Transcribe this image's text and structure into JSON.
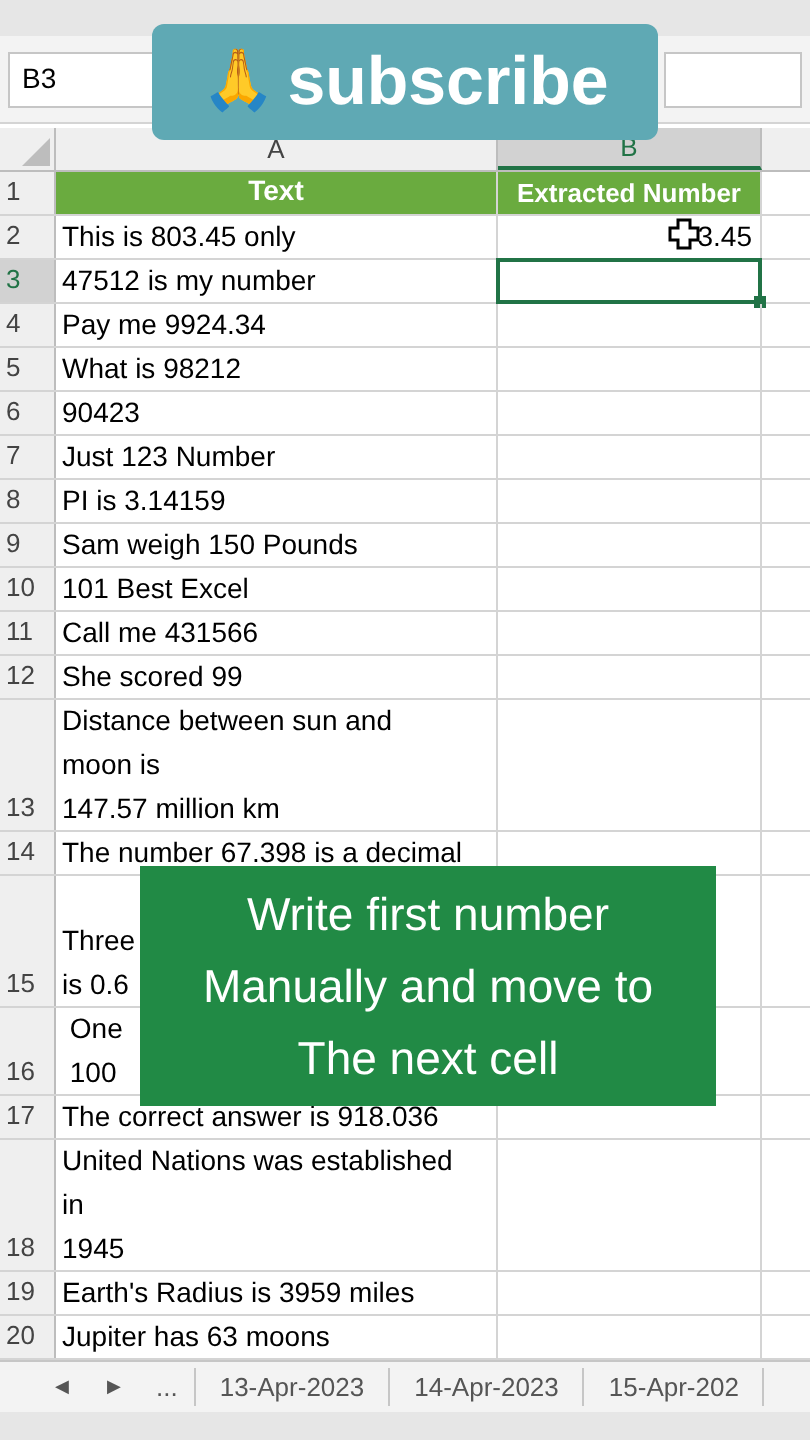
{
  "name_box": {
    "value": "B3"
  },
  "columns": [
    {
      "label": "A",
      "selected": false
    },
    {
      "label": "B",
      "selected": true
    }
  ],
  "rows": [
    {
      "number": "1",
      "a": "Text",
      "b": "Extracted Number",
      "kind": "header",
      "selected": false
    },
    {
      "number": "2",
      "a": "This is 803.45 only",
      "b": "3.45",
      "kind": "data",
      "selected": false
    },
    {
      "number": "3",
      "a": "47512 is my number",
      "b": "",
      "kind": "data",
      "selected": true
    },
    {
      "number": "4",
      "a": "Pay me 9924.34",
      "kind": "data",
      "selected": false
    },
    {
      "number": "5",
      "a": "What is 98212",
      "kind": "data",
      "selected": false
    },
    {
      "number": "6",
      "a": "90423",
      "kind": "data",
      "selected": false
    },
    {
      "number": "7",
      "a": "Just 123 Number",
      "kind": "data",
      "selected": false
    },
    {
      "number": "8",
      "a": "PI is 3.14159",
      "kind": "data",
      "selected": false
    },
    {
      "number": "9",
      "a": "Sam weigh 150 Pounds",
      "kind": "data",
      "selected": false
    },
    {
      "number": "10",
      "a": "101 Best Excel",
      "kind": "data",
      "selected": false
    },
    {
      "number": "11",
      "a": "Call me 431566",
      "kind": "data",
      "selected": false
    },
    {
      "number": "12",
      "a": "She scored 99",
      "kind": "data",
      "selected": false
    },
    {
      "number": "13",
      "a": "Distance between sun and\nmoon is\n147.57 million km",
      "kind": "data",
      "selected": false
    },
    {
      "number": "14",
      "a": "The number 67.398 is a decimal",
      "kind": "data",
      "selected": false
    },
    {
      "number": "15",
      "a": "\nThree\nis 0.6",
      "kind": "data",
      "selected": false
    },
    {
      "number": "16",
      "a": " One\n 100",
      "kind": "data",
      "selected": false
    },
    {
      "number": "17",
      "a": "The correct answer is 918.036",
      "kind": "data",
      "selected": false
    },
    {
      "number": "18",
      "a": "United Nations was established\nin\n1945",
      "kind": "data",
      "selected": false
    },
    {
      "number": "19",
      "a": "Earth's Radius is 3959 miles",
      "kind": "data",
      "selected": false
    },
    {
      "number": "20",
      "a": "Jupiter has 63 moons",
      "kind": "data",
      "selected": false
    }
  ],
  "sheet_tabs": {
    "prev": "◀",
    "next": "▶",
    "more": "...",
    "tabs": [
      {
        "label": "13-Apr-2023",
        "selected": false
      },
      {
        "label": "14-Apr-2023",
        "selected": false
      },
      {
        "label": "15-Apr-202",
        "selected": false
      }
    ]
  },
  "subscribe_banner": {
    "icon": "🙏",
    "label": "subscribe"
  },
  "caption": "Write first number\nManually and move to\nThe next cell"
}
